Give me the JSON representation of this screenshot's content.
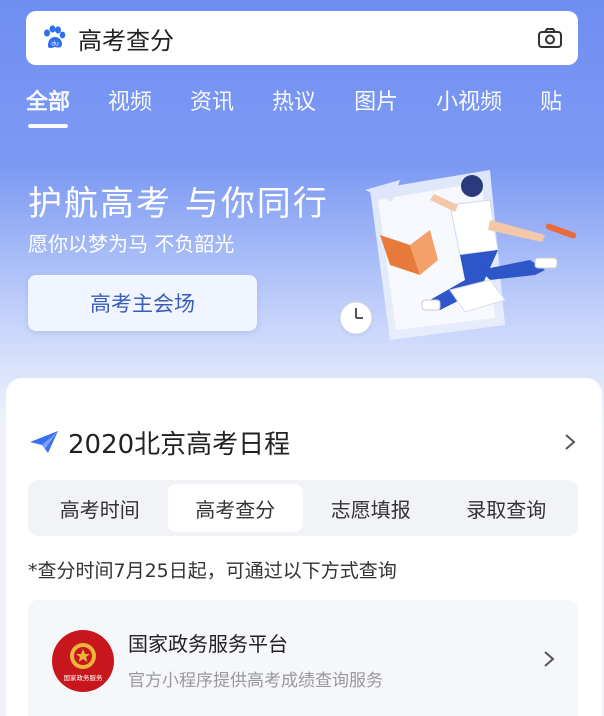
{
  "search": {
    "query": "高考查分",
    "logo_icon": "baidu-paw-icon",
    "camera_icon": "camera-icon"
  },
  "tabs": [
    {
      "label": "全部",
      "active": true
    },
    {
      "label": "视频"
    },
    {
      "label": "资讯"
    },
    {
      "label": "热议"
    },
    {
      "label": "图片"
    },
    {
      "label": "小视频"
    },
    {
      "label": "贴"
    }
  ],
  "hero": {
    "title": "护航高考 与你同行",
    "subtitle": "愿你以梦为马 不负韶光",
    "button": "高考主会场"
  },
  "schedule": {
    "title": "2020北京高考日程",
    "segments": [
      {
        "label": "高考时间"
      },
      {
        "label": "高考查分",
        "active": true
      },
      {
        "label": "志愿填报"
      },
      {
        "label": "录取查询"
      }
    ],
    "note": "*查分时间7月25日起，可通过以下方式查询",
    "service": {
      "name": "国家政务服务平台",
      "desc": "官方小程序提供高考成绩查询服务",
      "emblem_text": "国家政务服务"
    }
  },
  "colors": {
    "accent": "#3a5db8",
    "hero_top": "#6f8ef2",
    "emblem": "#c8161d"
  }
}
